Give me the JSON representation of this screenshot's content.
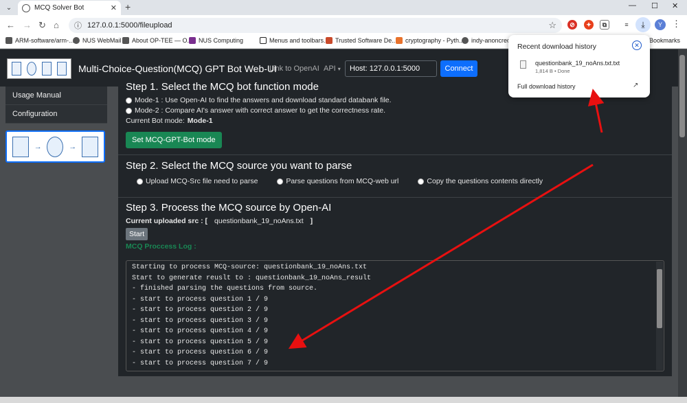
{
  "browser": {
    "tab_title": "MCQ Solver Bot",
    "url": "127.0.0.1:5000/fileupload",
    "bookmarks": [
      "ARM-software/arm-...",
      "NUS WebMail",
      "About OP-TEE — O...",
      "NUS Computing",
      "Menus and toolbars...",
      "Trusted Software De...",
      "cryptography - Pyth...",
      "indy-anoncreds",
      "Bookmarks"
    ],
    "profile_initial": "Y"
  },
  "download_popup": {
    "title": "Recent download history",
    "file_name": "questionbank_19_noAns.txt.txt",
    "file_meta": "1,814 B • Done",
    "full_history": "Full download history"
  },
  "app": {
    "brand": "Multi-Choice-Question(MCQ) GPT Bot Web-UI",
    "nav_openai": "Link to OpenAI",
    "nav_api": "API",
    "host_value": "Host: 127.0.0.1:5000",
    "connect": "Connect"
  },
  "sidebar": {
    "items": [
      "Usage Manual",
      "Configuration"
    ]
  },
  "step1": {
    "title": "Step 1. Select the MCQ bot function mode",
    "mode1": "Mode-1 : Use Open-AI to find the answers and download standard databank file.",
    "mode2": "Mode-2 : Compare AI's answer with correct answer to get the correctness rate.",
    "current_label": "Current Bot mode: ",
    "current_value": "Mode-1",
    "button": "Set MCQ-GPT-Bot mode"
  },
  "step2": {
    "title": "Step 2. Select the MCQ source you want to parse",
    "options": [
      "Upload MCQ-Src file need to parse",
      "Parse questions from MCQ-web url",
      "Copy the questions contents directly"
    ]
  },
  "step3": {
    "title": "Step 3. Process the MCQ source by Open-AI",
    "src_label": "Current uploaded src : [",
    "src_value": "questionbank_19_noAns.txt",
    "src_close": "]",
    "start": "Start",
    "log_title": "MCQ Proccess Log :",
    "log": [
      "Starting to process MCQ-source: questionbank_19_noAns.txt",
      "Start to generate reuslt to : questionbank_19_noAns_result",
      "- finished parsing the questions from source.",
      "- start to process question 1 / 9",
      "- start to process question 2 / 9",
      "- start to process question 3 / 9",
      "- start to process question 4 / 9",
      "- start to process question 5 / 9",
      "- start to process question 6 / 9",
      "- start to process question 7 / 9"
    ]
  },
  "colors": {
    "annotation_arrow": "#e81010",
    "primary": "#0d6efd",
    "success": "#198754",
    "panel_bg": "#212529"
  }
}
